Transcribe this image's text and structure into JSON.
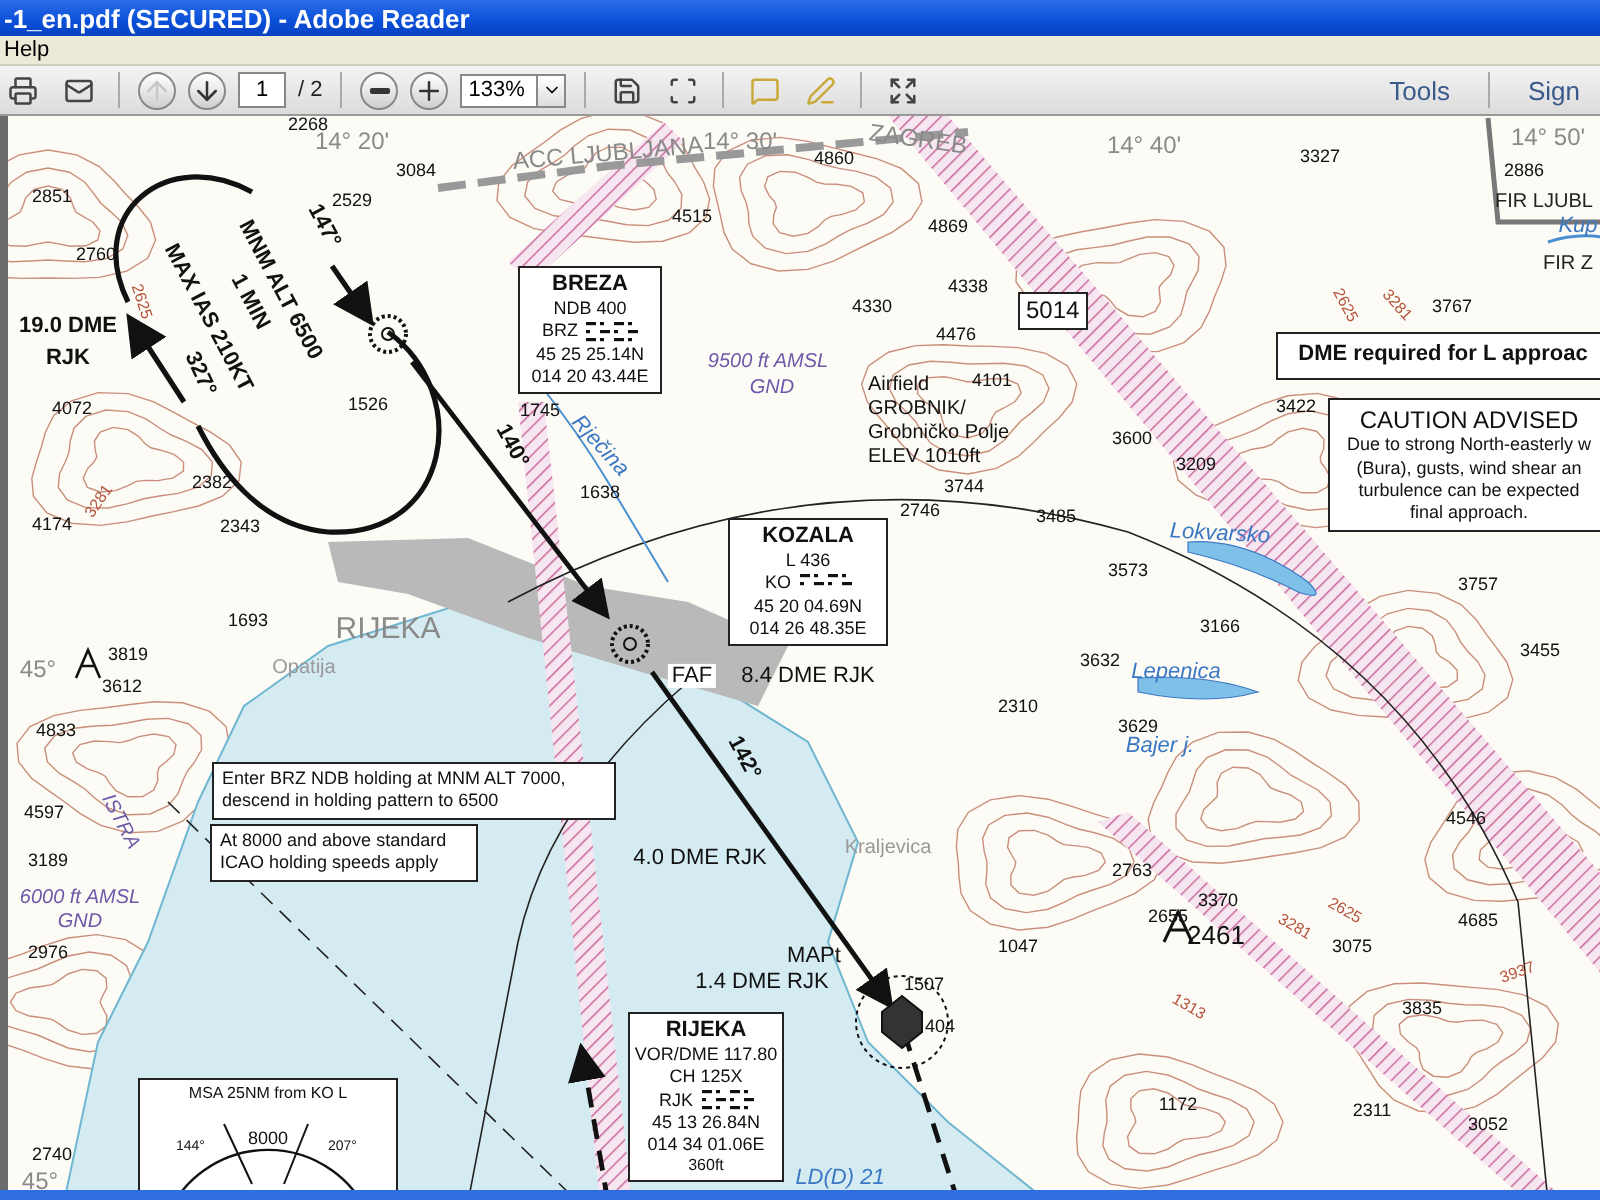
{
  "window": {
    "title": "-1_en.pdf (SECURED) - Adobe Reader"
  },
  "menu": [
    "Help"
  ],
  "toolbar": {
    "buttons": [
      {
        "kind": "print",
        "disabled": false
      },
      {
        "kind": "email",
        "disabled": false
      },
      {
        "kind": "prev",
        "disabled": true
      },
      {
        "kind": "next",
        "disabled": false
      }
    ],
    "page": "1",
    "page_total": "/ 2",
    "zoom_buttons": [
      {
        "kind": "zoom-out",
        "disabled": false
      },
      {
        "kind": "zoom-in",
        "disabled": false
      }
    ],
    "zoom": "133%",
    "view_buttons": [
      {
        "kind": "save",
        "disabled": false
      },
      {
        "kind": "fit",
        "disabled": false
      },
      {
        "kind": "comment",
        "disabled": false
      },
      {
        "kind": "sign",
        "disabled": false
      },
      {
        "kind": "fullscreen",
        "disabled": false
      }
    ],
    "links": [
      "Tools",
      "Sign"
    ]
  },
  "chart": {
    "labels": [
      {
        "kind": "coord",
        "text": "14° 20'"
      },
      {
        "kind": "spot",
        "text": "2268"
      },
      {
        "kind": "coord",
        "text": "14° 30'"
      },
      {
        "kind": "spot",
        "text": "4860"
      },
      {
        "kind": "coord",
        "text": "14° 40'"
      },
      {
        "kind": "spot",
        "text": "3327"
      },
      {
        "kind": "coord",
        "text": "14° 50'"
      },
      {
        "kind": "spot",
        "text": "2886"
      },
      {
        "kind": "coord",
        "text": "ACC LJUBLJANA"
      },
      {
        "kind": "coord",
        "text": "ZAGREB"
      },
      {
        "kind": "plain",
        "text": "FIR LJUBL"
      },
      {
        "kind": "water",
        "text": "Kup"
      },
      {
        "kind": "plain",
        "text": "FIR Z"
      },
      {
        "kind": "spot",
        "text": "2851"
      },
      {
        "kind": "spot",
        "text": "2529"
      },
      {
        "kind": "spot",
        "text": "3084"
      },
      {
        "kind": "spot",
        "text": "4515"
      },
      {
        "kind": "spot",
        "text": "4869"
      },
      {
        "kind": "spot",
        "text": "2760"
      },
      {
        "kind": "track",
        "text": "147°"
      },
      {
        "kind": "track",
        "text": "MNM ALT 6500"
      },
      {
        "kind": "track",
        "text": "1 MIN"
      },
      {
        "kind": "track",
        "text": "MAX IAS 210KT"
      },
      {
        "kind": "track",
        "text": "19.0 DME"
      },
      {
        "kind": "track",
        "text": "RJK"
      },
      {
        "kind": "track",
        "text": "327°"
      },
      {
        "kind": "spot",
        "text": "4072"
      },
      {
        "kind": "spot",
        "text": "1526"
      },
      {
        "kind": "spot",
        "text": "1745"
      },
      {
        "kind": "water",
        "text": "Rječina"
      },
      {
        "kind": "track",
        "text": "140°"
      },
      {
        "kind": "spot",
        "text": "2382"
      },
      {
        "kind": "spot",
        "text": "4174"
      },
      {
        "kind": "spot",
        "text": "2343"
      },
      {
        "kind": "spot",
        "text": "1638"
      },
      {
        "kind": "contour",
        "text": "2625"
      },
      {
        "kind": "contour",
        "text": "3281"
      },
      {
        "kind": "spot",
        "text": "4330"
      },
      {
        "kind": "spot",
        "text": "4338"
      },
      {
        "kind": "spot",
        "text": "4476"
      },
      {
        "kind": "airspace",
        "text": "9500 ft AMSL"
      },
      {
        "kind": "airspace",
        "text": "GND"
      },
      {
        "kind": "airfield",
        "text": "Airfield"
      },
      {
        "kind": "airfield",
        "text": "GROBNIK/"
      },
      {
        "kind": "airfield",
        "text": "Grobničko Polje"
      },
      {
        "kind": "airfield",
        "text": "ELEV 1010ft"
      },
      {
        "kind": "spot",
        "text": "4101"
      },
      {
        "kind": "spot",
        "text": "3600"
      },
      {
        "kind": "spot",
        "text": "3209"
      },
      {
        "kind": "spot",
        "text": "3422"
      },
      {
        "kind": "spot",
        "text": "3744"
      },
      {
        "kind": "spot",
        "text": "2746"
      },
      {
        "kind": "spot",
        "text": "3485"
      },
      {
        "kind": "water",
        "text": "Lokvarsko"
      },
      {
        "kind": "spot",
        "text": "3573"
      },
      {
        "kind": "spot",
        "text": "3166"
      },
      {
        "kind": "spot",
        "text": "3632"
      },
      {
        "kind": "spot",
        "text": "3767"
      },
      {
        "kind": "spot",
        "text": "3757"
      },
      {
        "kind": "spot",
        "text": "3455"
      },
      {
        "kind": "contour",
        "text": "2625"
      },
      {
        "kind": "contour",
        "text": "3281"
      },
      {
        "kind": "place",
        "text": "RIJEKA"
      },
      {
        "kind": "town",
        "text": "Opatija"
      },
      {
        "kind": "spot",
        "text": "3819"
      },
      {
        "kind": "spot",
        "text": "3612"
      },
      {
        "kind": "coord",
        "text": "45°"
      },
      {
        "kind": "spot",
        "text": "4833"
      },
      {
        "kind": "spot",
        "text": "1693"
      },
      {
        "kind": "fix",
        "text": "FAF"
      },
      {
        "kind": "dme",
        "text": "8.4 DME RJK"
      },
      {
        "kind": "track",
        "text": "142°"
      },
      {
        "kind": "airspace",
        "text": "ISTRA"
      },
      {
        "kind": "spot",
        "text": "4597"
      },
      {
        "kind": "spot",
        "text": "3189"
      },
      {
        "kind": "airspace",
        "text": "6000 ft AMSL"
      },
      {
        "kind": "airspace",
        "text": "GND"
      },
      {
        "kind": "spot",
        "text": "2976"
      },
      {
        "kind": "dme",
        "text": "4.0 DME RJK"
      },
      {
        "kind": "town",
        "text": "Kraljevica"
      },
      {
        "kind": "spot",
        "text": "2310"
      },
      {
        "kind": "water",
        "text": "Lepenica"
      },
      {
        "kind": "spot",
        "text": "3629"
      },
      {
        "kind": "water",
        "text": "Bajer j."
      },
      {
        "kind": "spot",
        "text": "2763"
      },
      {
        "kind": "spot",
        "text": "3370"
      },
      {
        "kind": "spot",
        "text": "2655"
      },
      {
        "kind": "peak",
        "text": "2461"
      },
      {
        "kind": "spot",
        "text": "3075"
      },
      {
        "kind": "spot",
        "text": "4546"
      },
      {
        "kind": "spot",
        "text": "4685"
      },
      {
        "kind": "spot",
        "text": "3835"
      },
      {
        "kind": "spot",
        "text": "1047"
      },
      {
        "kind": "dme",
        "text": "MAPt"
      },
      {
        "kind": "dme",
        "text": "1.4 DME RJK"
      },
      {
        "kind": "spot",
        "text": "1507"
      },
      {
        "kind": "spot",
        "text": "404"
      },
      {
        "kind": "spot",
        "text": "1172"
      },
      {
        "kind": "spot",
        "text": "2311"
      },
      {
        "kind": "spot",
        "text": "3052"
      },
      {
        "kind": "spot",
        "text": "2740"
      },
      {
        "kind": "coord",
        "text": "45°"
      },
      {
        "kind": "water",
        "text": "LD(D) 21"
      },
      {
        "kind": "contour",
        "text": "2625"
      },
      {
        "kind": "contour",
        "text": "3281"
      },
      {
        "kind": "contour",
        "text": "1313"
      },
      {
        "kind": "contour",
        "text": "3937"
      }
    ],
    "boxes": [
      {
        "kind": "navaid",
        "title": "BREZA",
        "freq": [
          "NDB 400"
        ],
        "ident": "BRZ",
        "coords": [
          "45 25 25.14N",
          "014 20 43.44E"
        ]
      },
      {
        "kind": "tag",
        "lines": [
          "5014"
        ]
      },
      {
        "kind": "banner",
        "lines": [
          "DME required for L approac"
        ]
      },
      {
        "kind": "caution",
        "title": "CAUTION ADVISED",
        "lines": [
          "Due to strong North-easterly w",
          "(Bura), gusts, wind shear an",
          "turbulence can be expected",
          "final approach."
        ]
      },
      {
        "kind": "navaid",
        "title": "KOZALA",
        "freq": [
          "L 436"
        ],
        "ident": "KO",
        "coords": [
          "45 20 04.69N",
          "014 26 48.35E"
        ]
      },
      {
        "kind": "note",
        "lines": [
          "Enter BRZ NDB holding at MNM ALT 7000,",
          "descend in holding pattern to 6500"
        ]
      },
      {
        "kind": "note",
        "lines": [
          "At 8000 and above standard",
          "ICAO holding speeds apply"
        ]
      },
      {
        "kind": "navaid",
        "title": "RIJEKA",
        "freq": [
          "VOR/DME 117.80",
          "CH 125X"
        ],
        "ident": "RJK",
        "coords": [
          "45 13 26.84N",
          "014 34 01.06E"
        ],
        "elevation": "360ft"
      },
      {
        "kind": "msa",
        "title": "MSA 25NM from  KO L",
        "lines": [
          "8000",
          "144°",
          "207°"
        ]
      }
    ]
  }
}
